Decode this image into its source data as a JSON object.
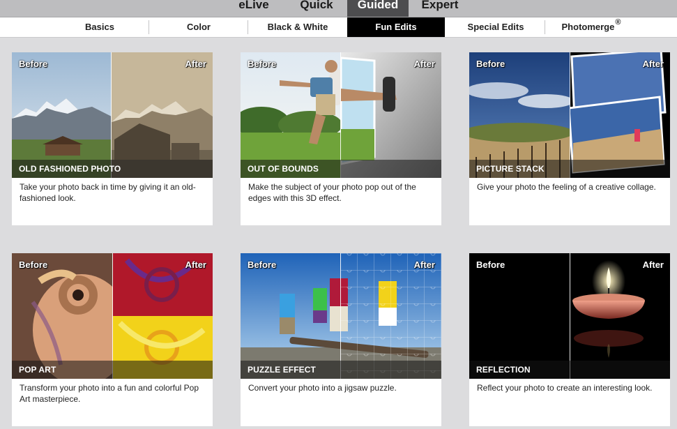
{
  "modes": {
    "elive": "eLive",
    "quick": "Quick",
    "guided": "Guided",
    "expert": "Expert",
    "active": "Guided"
  },
  "tabs": {
    "basics": "Basics",
    "color": "Color",
    "black_white": "Black & White",
    "fun_edits": "Fun Edits",
    "special_edits": "Special Edits",
    "photomerge": "Photomerge",
    "photomerge_mark": "®",
    "active": "Fun Edits"
  },
  "labels": {
    "before": "Before",
    "after": "After"
  },
  "cards": [
    {
      "title": "OLD FASHIONED PHOTO",
      "description": "Take your photo back in time by giving it an old-fashioned look."
    },
    {
      "title": "OUT OF BOUNDS",
      "description": "Make the subject of your photo pop out of the edges with this 3D effect."
    },
    {
      "title": "PICTURE STACK",
      "description": "Give your photo the feeling of a creative collage."
    },
    {
      "title": "POP ART",
      "description": "Transform your photo into a fun and colorful Pop Art masterpiece."
    },
    {
      "title": "PUZZLE EFFECT",
      "description": "Convert your photo into a jigsaw puzzle."
    },
    {
      "title": "REFLECTION",
      "description": "Reflect your photo to create an interesting look."
    }
  ],
  "colors": {
    "page_bg": "#dcdcde",
    "mode_bar": "#bdbdbf",
    "active_mode": "#4d4d4f",
    "active_tab": "#000000"
  }
}
